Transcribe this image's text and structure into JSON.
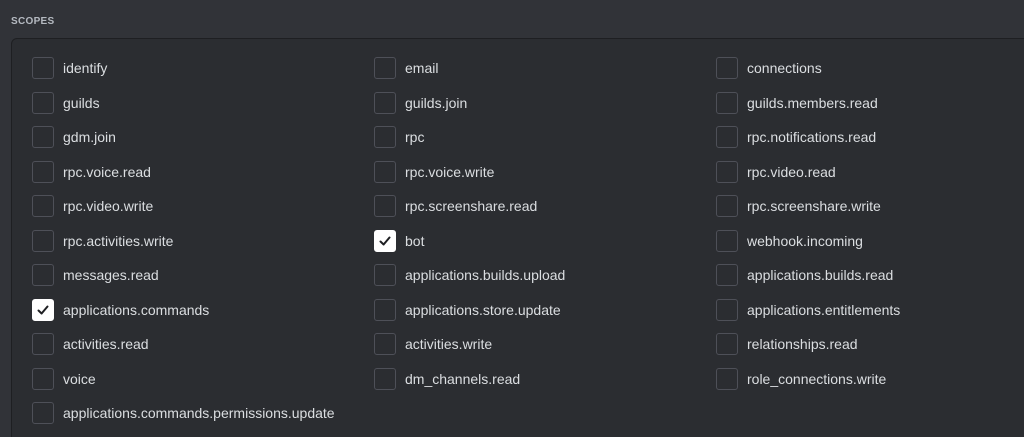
{
  "section": {
    "title": "SCOPES"
  },
  "colors": {
    "background": "#313338",
    "panel": "#2b2d31",
    "checkbox_checked": "#ffffff",
    "label_text": "#dbdee1"
  },
  "scopes": [
    {
      "label": "identify",
      "checked": false
    },
    {
      "label": "email",
      "checked": false
    },
    {
      "label": "connections",
      "checked": false
    },
    {
      "label": "guilds",
      "checked": false
    },
    {
      "label": "guilds.join",
      "checked": false
    },
    {
      "label": "guilds.members.read",
      "checked": false
    },
    {
      "label": "gdm.join",
      "checked": false
    },
    {
      "label": "rpc",
      "checked": false
    },
    {
      "label": "rpc.notifications.read",
      "checked": false
    },
    {
      "label": "rpc.voice.read",
      "checked": false
    },
    {
      "label": "rpc.voice.write",
      "checked": false
    },
    {
      "label": "rpc.video.read",
      "checked": false
    },
    {
      "label": "rpc.video.write",
      "checked": false
    },
    {
      "label": "rpc.screenshare.read",
      "checked": false
    },
    {
      "label": "rpc.screenshare.write",
      "checked": false
    },
    {
      "label": "rpc.activities.write",
      "checked": false
    },
    {
      "label": "bot",
      "checked": true
    },
    {
      "label": "webhook.incoming",
      "checked": false
    },
    {
      "label": "messages.read",
      "checked": false
    },
    {
      "label": "applications.builds.upload",
      "checked": false
    },
    {
      "label": "applications.builds.read",
      "checked": false
    },
    {
      "label": "applications.commands",
      "checked": true
    },
    {
      "label": "applications.store.update",
      "checked": false
    },
    {
      "label": "applications.entitlements",
      "checked": false
    },
    {
      "label": "activities.read",
      "checked": false
    },
    {
      "label": "activities.write",
      "checked": false
    },
    {
      "label": "relationships.read",
      "checked": false
    },
    {
      "label": "voice",
      "checked": false
    },
    {
      "label": "dm_channels.read",
      "checked": false
    },
    {
      "label": "role_connections.write",
      "checked": false
    },
    {
      "label": "applications.commands.permissions.update",
      "checked": false
    }
  ]
}
